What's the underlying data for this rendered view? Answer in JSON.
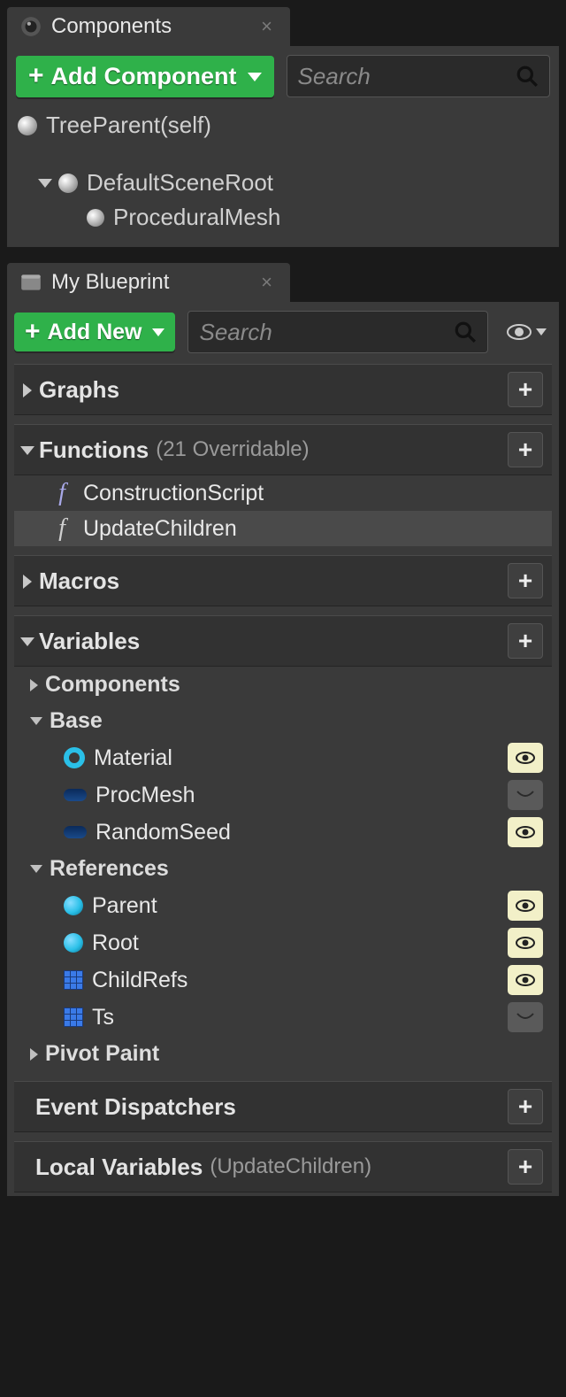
{
  "components_panel": {
    "tab_label": "Components",
    "add_btn": "Add Component",
    "search_placeholder": "Search",
    "tree": {
      "root": "TreeParent(self)",
      "scene_root": "DefaultSceneRoot",
      "mesh": "ProceduralMesh"
    }
  },
  "blueprint_panel": {
    "tab_label": "My Blueprint",
    "add_btn": "Add New",
    "search_placeholder": "Search",
    "sections": {
      "graphs": {
        "label": "Graphs"
      },
      "functions": {
        "label": "Functions",
        "subtitle": "(21 Overridable)",
        "items": [
          {
            "name": "ConstructionScript"
          },
          {
            "name": "UpdateChildren"
          }
        ]
      },
      "macros": {
        "label": "Macros"
      },
      "variables": {
        "label": "Variables",
        "groups": {
          "components": {
            "label": "Components"
          },
          "base": {
            "label": "Base",
            "items": [
              {
                "name": "Material",
                "icon": "circle-cyan",
                "visible": true
              },
              {
                "name": "ProcMesh",
                "icon": "pill-blue",
                "visible": false
              },
              {
                "name": "RandomSeed",
                "icon": "pill-blue",
                "visible": true
              }
            ]
          },
          "references": {
            "label": "References",
            "items": [
              {
                "name": "Parent",
                "icon": "ball-cyan",
                "visible": true
              },
              {
                "name": "Root",
                "icon": "ball-cyan",
                "visible": true
              },
              {
                "name": "ChildRefs",
                "icon": "grid-icon",
                "visible": true
              },
              {
                "name": "Ts",
                "icon": "grid-icon",
                "visible": false
              }
            ]
          },
          "pivot_paint": {
            "label": "Pivot Paint"
          }
        }
      },
      "event_dispatchers": {
        "label": "Event Dispatchers"
      },
      "local_variables": {
        "label": "Local Variables",
        "subtitle": "(UpdateChildren)"
      }
    }
  }
}
